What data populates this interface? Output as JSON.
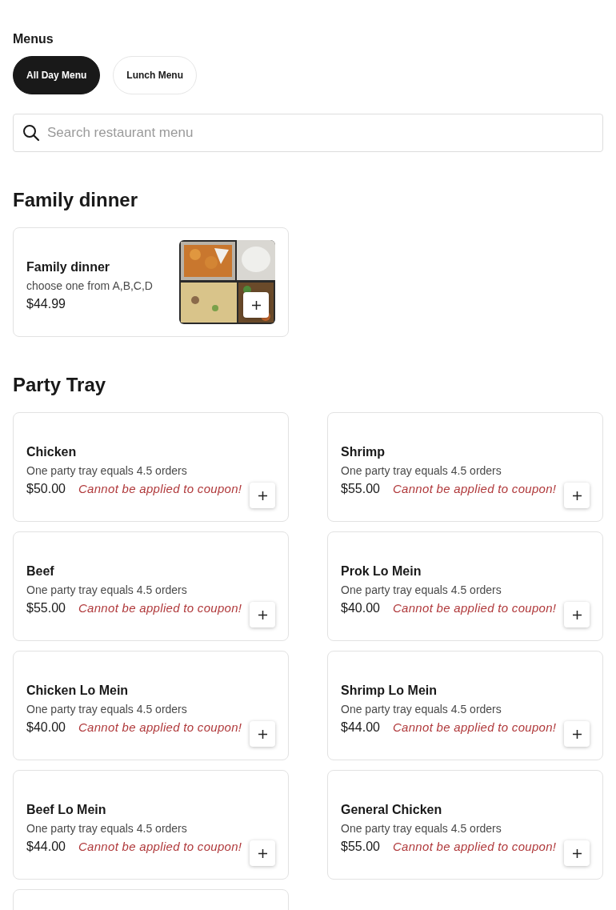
{
  "menus": {
    "title": "Menus",
    "tabs": [
      {
        "label": "All Day Menu",
        "selected": true
      },
      {
        "label": "Lunch Menu",
        "selected": false
      }
    ]
  },
  "search": {
    "placeholder": "Search restaurant menu"
  },
  "sections": [
    {
      "title": "Family dinner",
      "items": [
        {
          "kind": "picture_item",
          "name": "Family dinner",
          "description": "choose one from A,B,C,D",
          "price": "$44.99"
        }
      ]
    },
    {
      "title": "Party Tray",
      "items": [
        {
          "kind": "item",
          "name": "Chicken",
          "description": "One party tray equals 4.5 orders",
          "price": "$50.00",
          "note": "Cannot be applied to coupon!"
        },
        {
          "kind": "item",
          "name": "Shrimp",
          "description": "One party tray equals 4.5 orders",
          "price": "$55.00",
          "note": "Cannot be applied to coupon!"
        },
        {
          "kind": "item",
          "name": "Beef",
          "description": "One party tray equals 4.5 orders",
          "price": "$55.00",
          "note": "Cannot be applied to coupon!"
        },
        {
          "kind": "item",
          "name": "Prok Lo Mein",
          "description": "One party tray equals 4.5 orders",
          "price": "$40.00",
          "note": "Cannot be applied to coupon!"
        },
        {
          "kind": "item",
          "name": "Chicken Lo Mein",
          "description": "One party tray equals 4.5 orders",
          "price": "$40.00",
          "note": "Cannot be applied to coupon!"
        },
        {
          "kind": "item",
          "name": "Shrimp Lo Mein",
          "description": "One party tray equals 4.5 orders",
          "price": "$44.00",
          "note": "Cannot be applied to coupon!"
        },
        {
          "kind": "item",
          "name": "Beef Lo Mein",
          "description": "One party tray equals 4.5 orders",
          "price": "$44.00",
          "note": "Cannot be applied to coupon!"
        },
        {
          "kind": "item",
          "name": "General Chicken",
          "description": "One party tray equals 4.5 orders",
          "price": "$55.00",
          "note": "Cannot be applied to coupon!"
        },
        {
          "kind": "cut_off"
        }
      ]
    }
  ]
}
